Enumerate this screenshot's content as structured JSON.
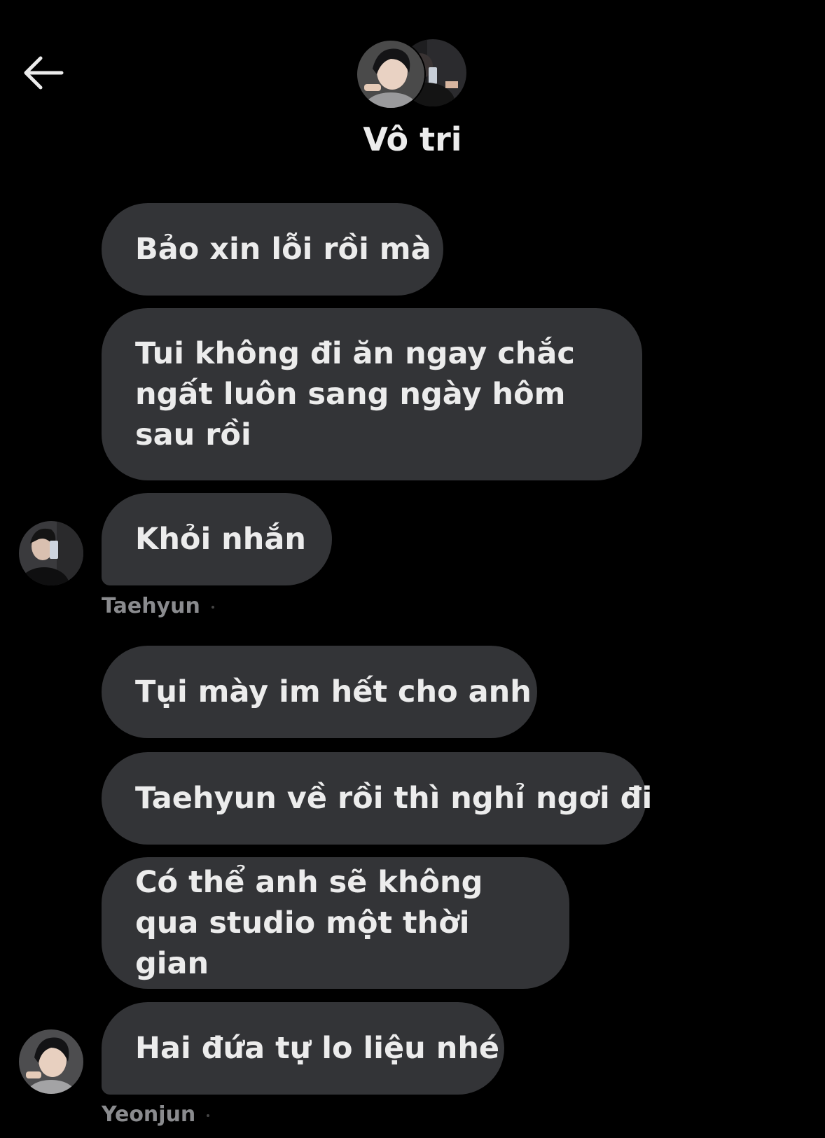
{
  "header": {
    "title": "Vô tri",
    "back_icon": "arrow-left-icon"
  },
  "messages": [
    {
      "text": "Bảo xin lỗi rồi mà"
    },
    {
      "text": "Tui không đi ăn ngay chắc ngất luôn sang ngày hôm sau rồi"
    },
    {
      "text": "Khỏi nhắn"
    },
    {
      "sender": "Taehyun"
    },
    {
      "text": "Tụi mày im hết cho anh"
    },
    {
      "text": "Taehyun về rồi thì nghỉ ngơi đi"
    },
    {
      "text": "Có thể anh sẽ không qua studio một thời gian"
    },
    {
      "text": "Hai đứa tự lo liệu nhé"
    },
    {
      "sender": "Yeonjun"
    }
  ],
  "colors": {
    "background": "#000000",
    "bubble": "#333437",
    "text": "#ececec",
    "sender_name": "#8a8b8e"
  }
}
